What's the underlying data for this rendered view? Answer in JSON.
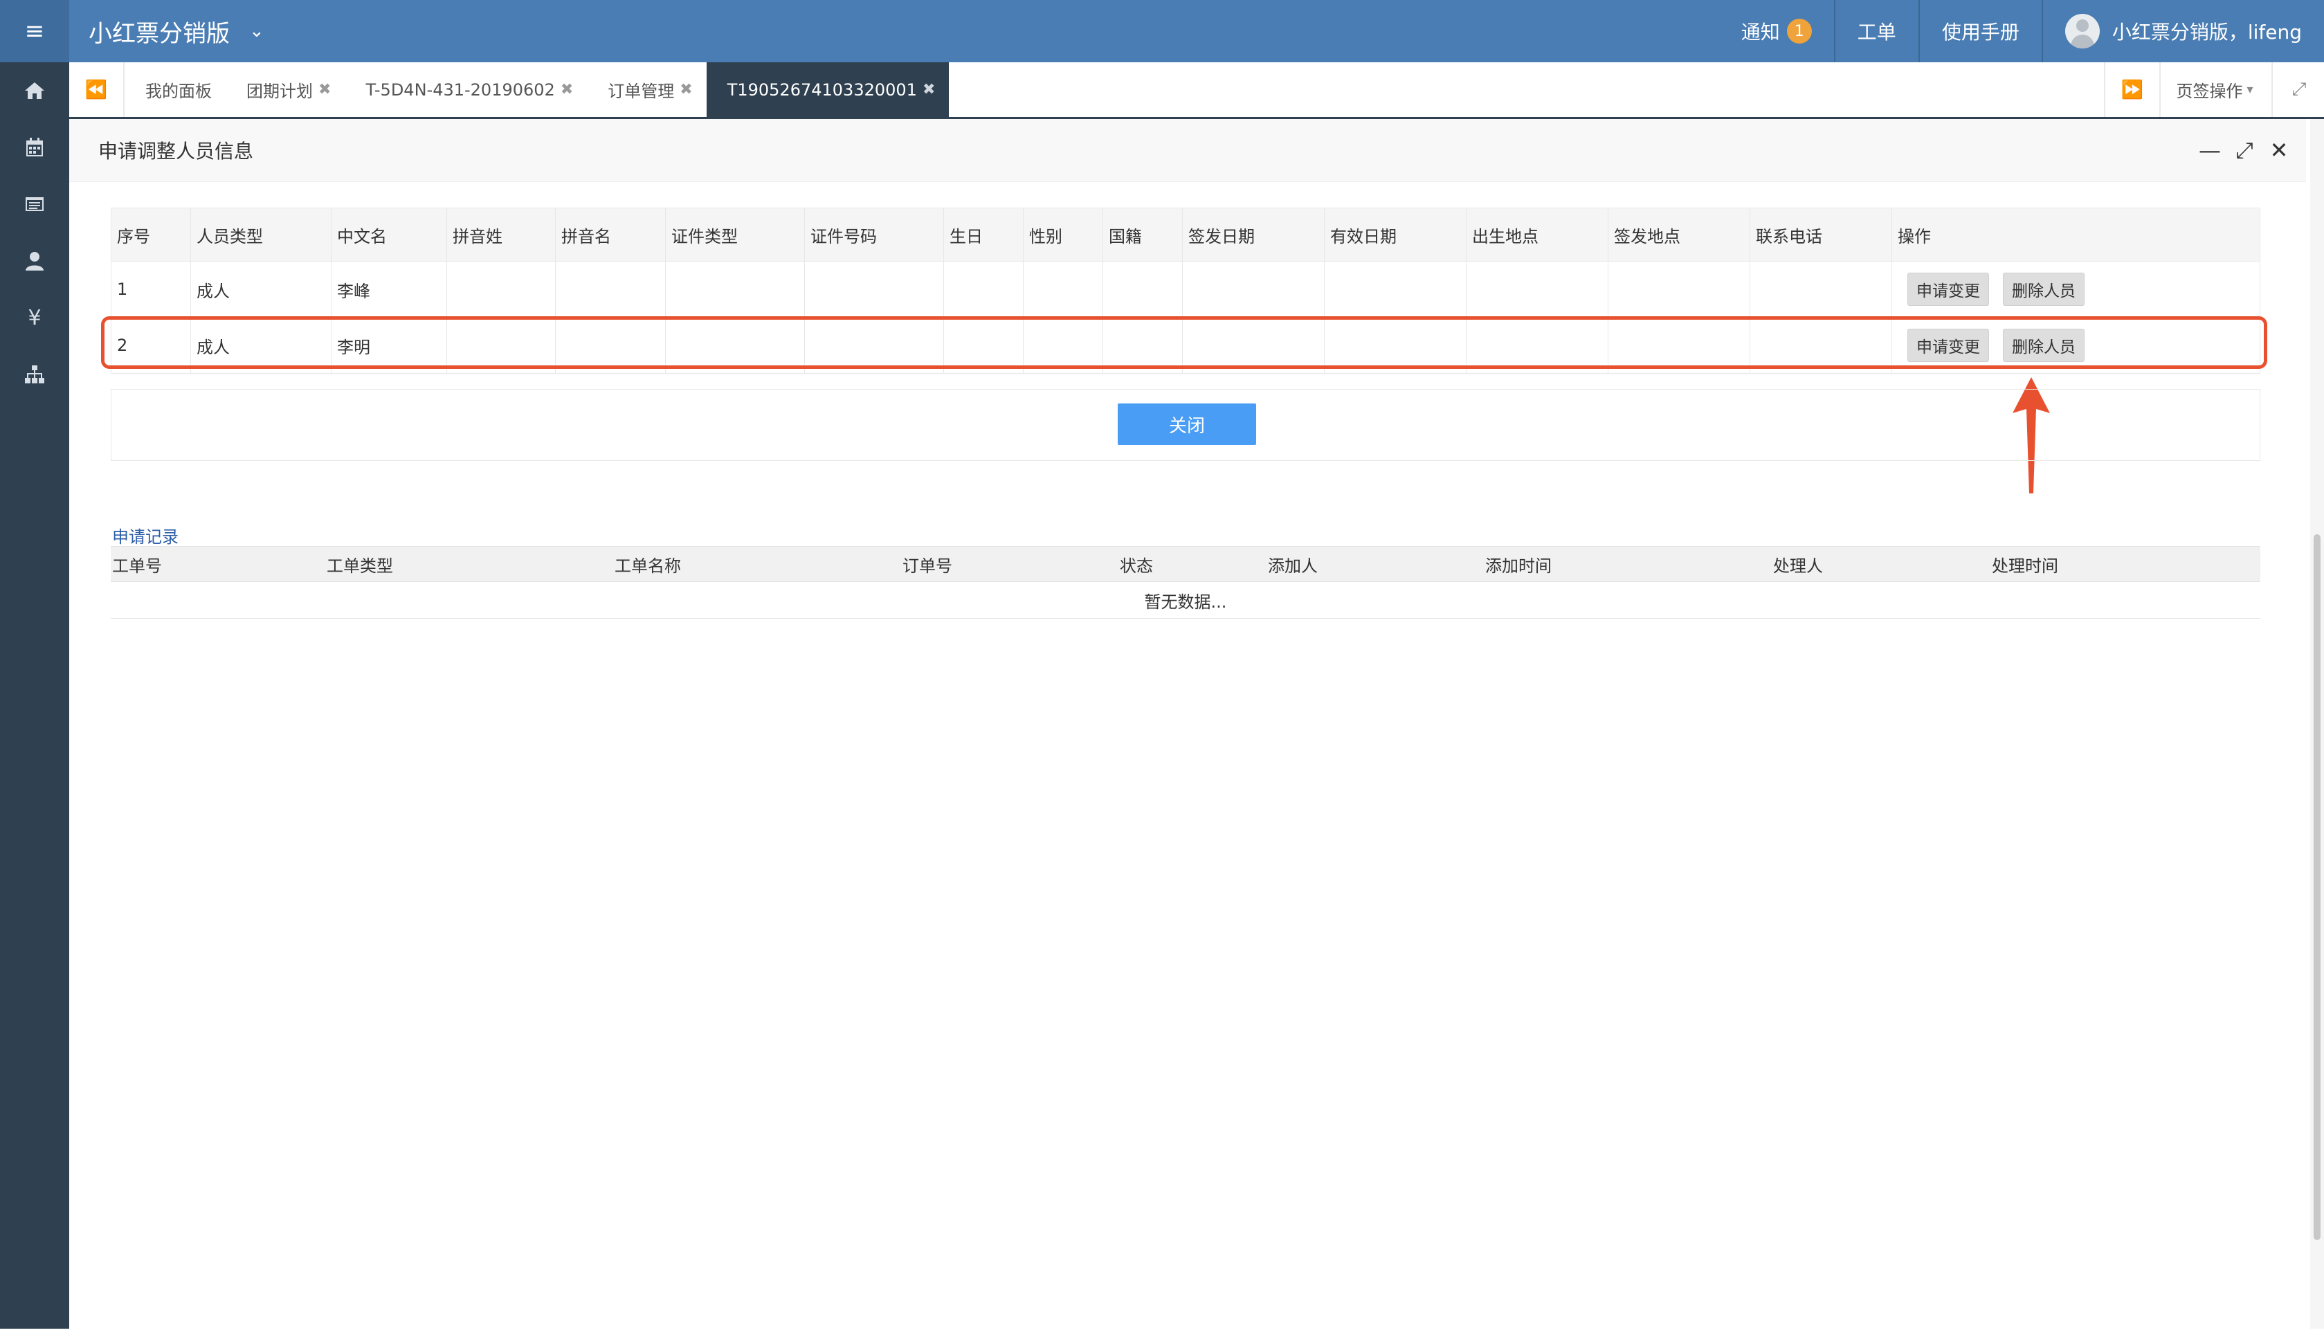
{
  "topbar": {
    "brand": "小红票分销版",
    "notify_label": "通知",
    "notify_count": "1",
    "ticket_label": "工单",
    "manual_label": "使用手册",
    "user_label": "小红票分销版，lifeng"
  },
  "tabs": {
    "items": [
      {
        "label": "我的面板",
        "closable": false
      },
      {
        "label": "团期计划",
        "closable": true
      },
      {
        "label": "T-5D4N-431-20190602",
        "closable": true
      },
      {
        "label": "订单管理",
        "closable": true
      },
      {
        "label": "T19052674103320001",
        "closable": true,
        "active": true
      }
    ],
    "ops_label": "页签操作"
  },
  "panel": {
    "title": "申请调整人员信息"
  },
  "people_table": {
    "headers": [
      "序号",
      "人员类型",
      "中文名",
      "拼音姓",
      "拼音名",
      "证件类型",
      "证件号码",
      "生日",
      "性别",
      "国籍",
      "签发日期",
      "有效日期",
      "出生地点",
      "签发地点",
      "联系电话",
      "操作"
    ],
    "rows": [
      {
        "no": "1",
        "type": "成人",
        "name": "李峰"
      },
      {
        "no": "2",
        "type": "成人",
        "name": "李明"
      }
    ],
    "change_label": "申请变更",
    "delete_label": "删除人员"
  },
  "close_label": "关闭",
  "records": {
    "title": "申请记录",
    "headers": [
      "工单号",
      "工单类型",
      "工单名称",
      "订单号",
      "状态",
      "添加人",
      "添加时间",
      "处理人",
      "处理时间"
    ],
    "empty_text": "暂无数据..."
  },
  "colors": {
    "topbar": "#4a7db3",
    "sidebar": "#2f4050",
    "highlight": "#e8512f",
    "primary_button": "#4a9df4"
  }
}
